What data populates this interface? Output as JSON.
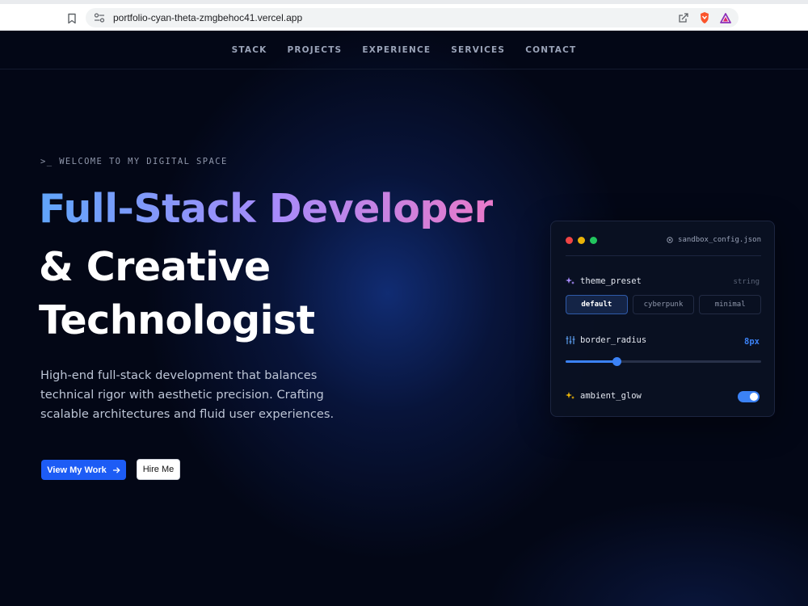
{
  "browser": {
    "url": "portfolio-cyan-theta-zmgbehoc41.vercel.app",
    "icons": [
      "bookmark-icon",
      "site-info-icon",
      "share-icon",
      "brave-shield-icon",
      "brave-rewards-icon"
    ]
  },
  "nav": {
    "items": [
      {
        "label": "STACK"
      },
      {
        "label": "PROJECTS"
      },
      {
        "label": "EXPERIENCE"
      },
      {
        "label": "SERVICES"
      },
      {
        "label": "CONTACT"
      }
    ]
  },
  "hero": {
    "eyebrow": "WELCOME TO MY DIGITAL SPACE",
    "eyebrow_prompt": ">_",
    "title_line1": "Full-Stack Developer",
    "title_line2": "& Creative",
    "title_line3": "Technologist",
    "description": "High-end full-stack development that balances technical rigor with aesthetic precision. Crafting scalable architectures and fluid user experiences.",
    "primary_button": "View My Work",
    "secondary_button": "Hire Me"
  },
  "config": {
    "filename": "sandbox_config.json",
    "theme_label": "theme_preset",
    "theme_type": "string",
    "theme_options": [
      {
        "label": "default",
        "active": true
      },
      {
        "label": "cyberpunk",
        "active": false
      },
      {
        "label": "minimal",
        "active": false
      }
    ],
    "radius_label": "border_radius",
    "radius_value": "8px",
    "radius_slider_fraction": 0.26,
    "glow_label": "ambient_glow",
    "glow_enabled": true
  },
  "colors": {
    "accent": "#3b82f6",
    "primary_button": "#1d5cf5",
    "gradient_start": "#60a5fa",
    "gradient_mid": "#a78bfa",
    "gradient_end": "#e879c9",
    "background": "#030716"
  }
}
